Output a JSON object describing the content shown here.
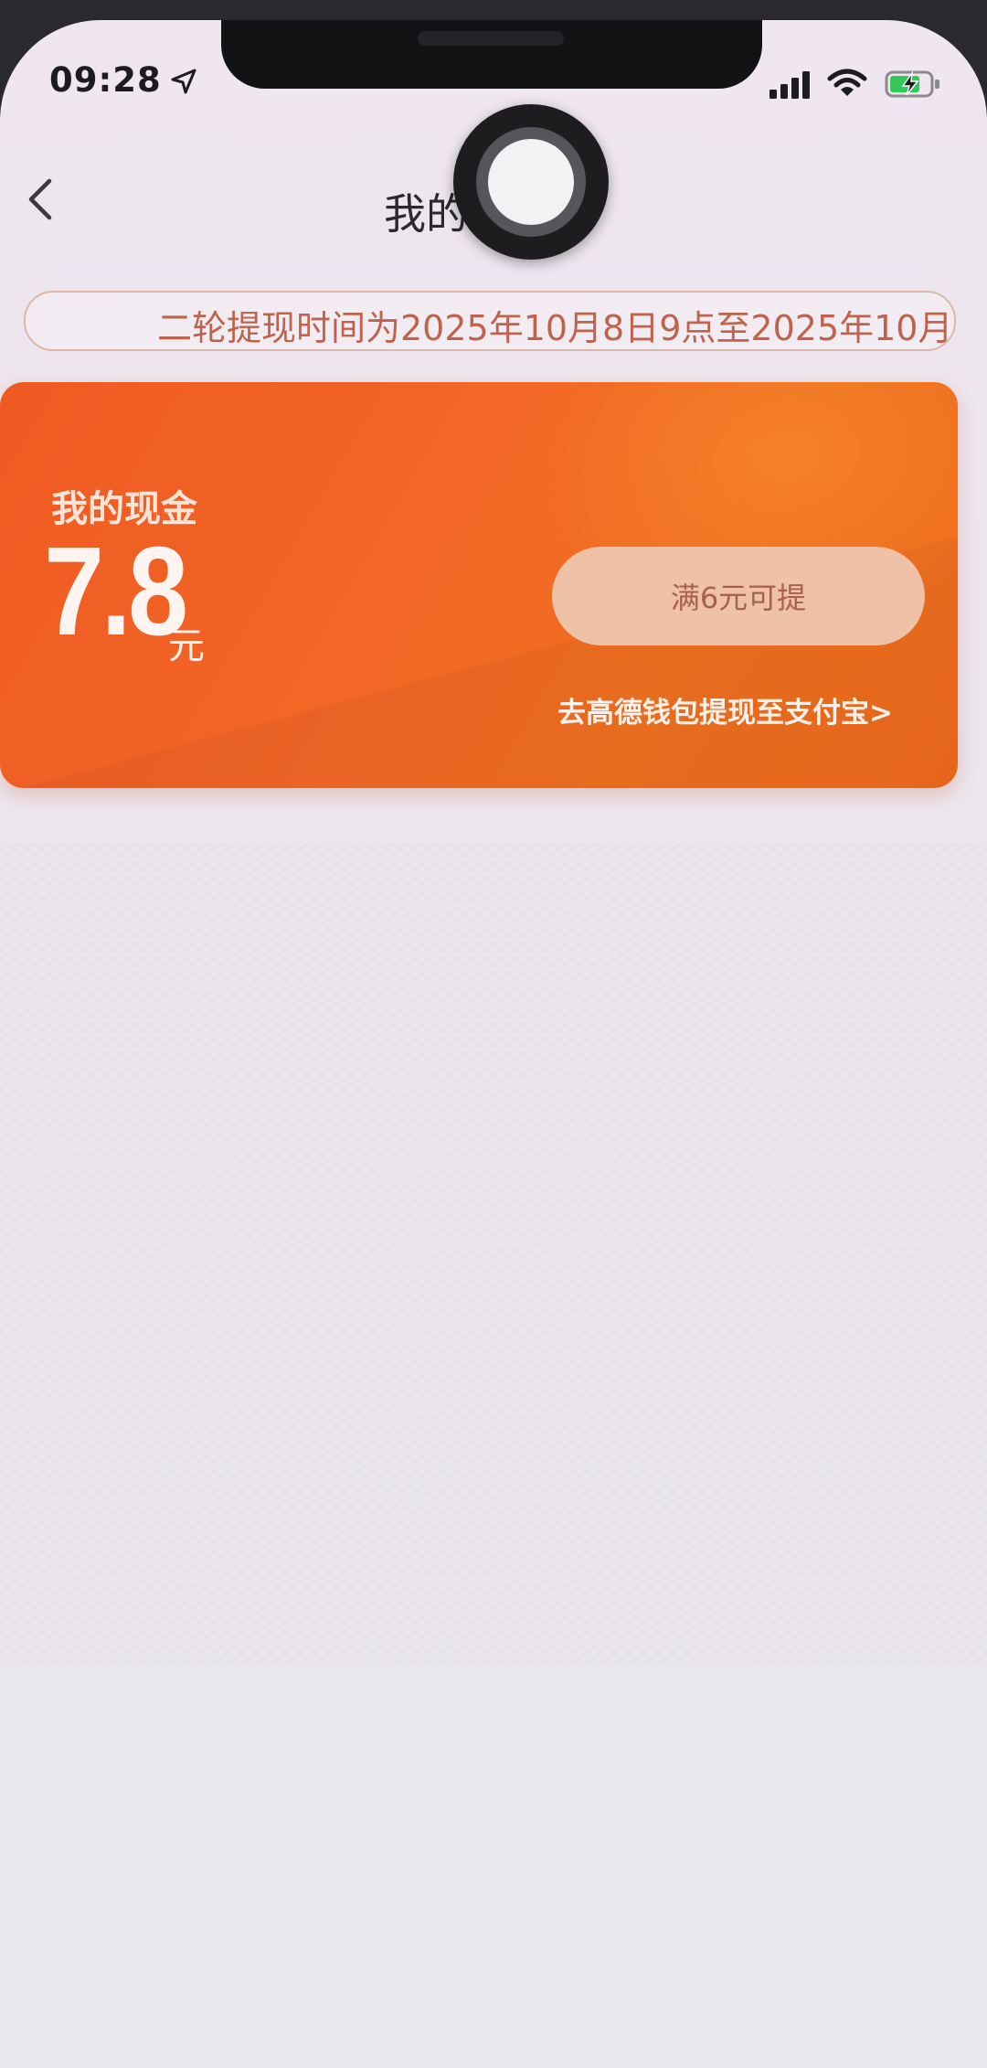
{
  "status_bar": {
    "time": "09:28",
    "location_icon": "location-arrow-icon",
    "signal_icon": "cellular-signal-icon",
    "wifi_icon": "wifi-icon",
    "battery_icon": "battery-charging-icon"
  },
  "nav": {
    "back_icon": "chevron-left-icon",
    "title": "我的"
  },
  "notice": {
    "text": "二轮提现时间为2025年10月8日9点至2025年10月"
  },
  "cash_card": {
    "label": "我的现金",
    "amount": "7.8",
    "unit": "元",
    "withdraw_button": "满6元可提",
    "alipay_link": "去高德钱包提现至支付宝>"
  },
  "colors": {
    "card_orange": "#f26726",
    "button_peach": "#efc1a6",
    "notice_text": "#c0634d"
  }
}
